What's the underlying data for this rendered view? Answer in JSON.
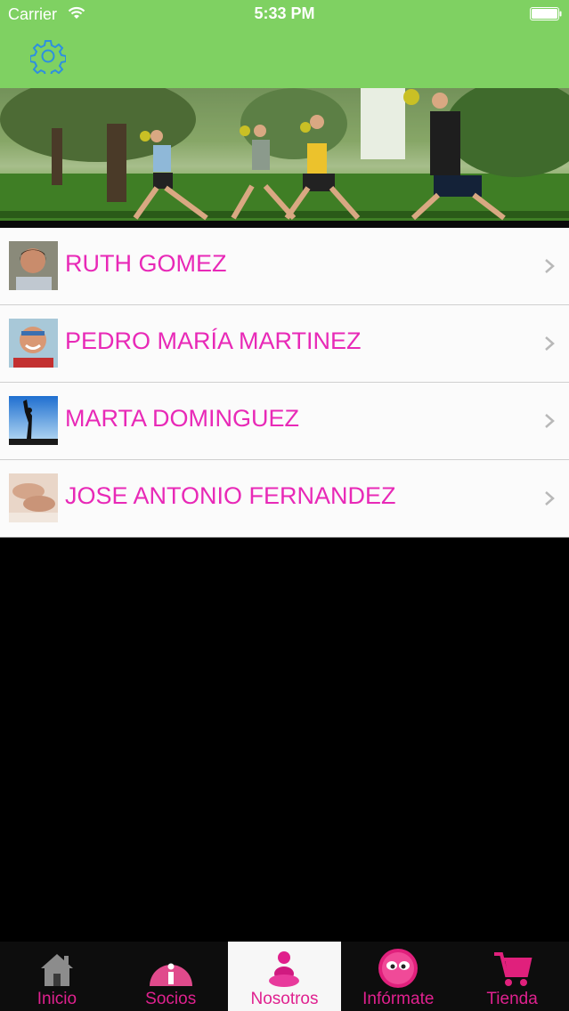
{
  "status_bar": {
    "carrier": "Carrier",
    "time": "5:33 PM"
  },
  "header": {
    "settings_icon": "gear-icon",
    "accent_color": "#7fd162"
  },
  "members": [
    {
      "name": "RUTH GOMEZ",
      "photo": "woman-portrait"
    },
    {
      "name": "PEDRO MARÍA MARTINEZ",
      "photo": "man-portrait"
    },
    {
      "name": "MARTA DOMINGUEZ",
      "photo": "yoga-silhouette"
    },
    {
      "name": "JOSE ANTONIO FERNANDEZ",
      "photo": "massage-hands"
    }
  ],
  "tabs": [
    {
      "label": "Inicio",
      "icon": "home-icon"
    },
    {
      "label": "Socios",
      "icon": "info-icon"
    },
    {
      "label": "Nosotros",
      "icon": "people-icon",
      "active": true
    },
    {
      "label": "Infórmate",
      "icon": "face-icon"
    },
    {
      "label": "Tienda",
      "icon": "cart-icon"
    }
  ],
  "colors": {
    "name_text": "#e829b7",
    "tab_label": "#e0218f",
    "tab_bar": "#0d0d0d"
  }
}
